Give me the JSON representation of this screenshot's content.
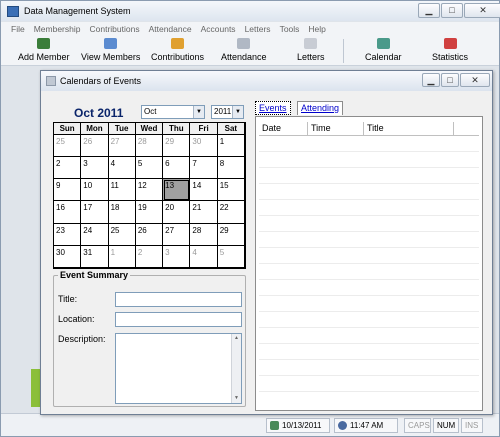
{
  "main_window": {
    "title": "Data Management System",
    "controls": {
      "minimize": "▁",
      "maximize": "□",
      "close": "✕"
    }
  },
  "menu": [
    "File",
    "Membership",
    "Contributions",
    "Attendance",
    "Accounts",
    "Letters",
    "Tools",
    "Help"
  ],
  "toolbar": [
    {
      "label": "Add Member",
      "icon": "add-member-icon",
      "color": "#3a7d3a"
    },
    {
      "label": "View Members",
      "icon": "view-members-icon",
      "color": "#5b8bd0"
    },
    {
      "label": "Contributions",
      "icon": "contributions-icon",
      "color": "#e0a030"
    },
    {
      "label": "Attendance",
      "icon": "attendance-icon",
      "color": "#b0b8c4"
    },
    {
      "label": "Letters",
      "icon": "letters-icon",
      "color": "#c8ccd4"
    },
    {
      "label": "Calendar",
      "icon": "calendar-icon",
      "color": "#4a9a8a"
    },
    {
      "label": "Statistics",
      "icon": "statistics-icon",
      "color": "#d04040"
    }
  ],
  "dialog": {
    "title": "Calendars of Events",
    "controls": {
      "minimize": "▁",
      "maximize": "□",
      "close": "✕"
    },
    "calendar": {
      "month_label": "Oct 2011",
      "month_select": "Oct",
      "year_select": "2011",
      "day_headers": [
        "Sun",
        "Mon",
        "Tue",
        "Wed",
        "Thu",
        "Fri",
        "Sat"
      ],
      "selected_day": "13",
      "weeks": [
        [
          {
            "d": "25",
            "o": true
          },
          {
            "d": "26",
            "o": true
          },
          {
            "d": "27",
            "o": true
          },
          {
            "d": "28",
            "o": true
          },
          {
            "d": "29",
            "o": true
          },
          {
            "d": "30",
            "o": true
          },
          {
            "d": "1",
            "o": false
          }
        ],
        [
          {
            "d": "2",
            "o": false
          },
          {
            "d": "3",
            "o": false
          },
          {
            "d": "4",
            "o": false
          },
          {
            "d": "5",
            "o": false
          },
          {
            "d": "6",
            "o": false
          },
          {
            "d": "7",
            "o": false
          },
          {
            "d": "8",
            "o": false
          }
        ],
        [
          {
            "d": "9",
            "o": false
          },
          {
            "d": "10",
            "o": false
          },
          {
            "d": "11",
            "o": false
          },
          {
            "d": "12",
            "o": false
          },
          {
            "d": "13",
            "o": false
          },
          {
            "d": "14",
            "o": false
          },
          {
            "d": "15",
            "o": false
          }
        ],
        [
          {
            "d": "16",
            "o": false
          },
          {
            "d": "17",
            "o": false
          },
          {
            "d": "18",
            "o": false
          },
          {
            "d": "19",
            "o": false
          },
          {
            "d": "20",
            "o": false
          },
          {
            "d": "21",
            "o": false
          },
          {
            "d": "22",
            "o": false
          }
        ],
        [
          {
            "d": "23",
            "o": false
          },
          {
            "d": "24",
            "o": false
          },
          {
            "d": "25",
            "o": false
          },
          {
            "d": "26",
            "o": false
          },
          {
            "d": "27",
            "o": false
          },
          {
            "d": "28",
            "o": false
          },
          {
            "d": "29",
            "o": false
          }
        ],
        [
          {
            "d": "30",
            "o": false
          },
          {
            "d": "31",
            "o": false
          },
          {
            "d": "1",
            "o": true
          },
          {
            "d": "2",
            "o": true
          },
          {
            "d": "3",
            "o": true
          },
          {
            "d": "4",
            "o": true
          },
          {
            "d": "5",
            "o": true
          }
        ]
      ]
    },
    "summary": {
      "legend": "Event Summary",
      "title_label": "Title:",
      "location_label": "Location:",
      "description_label": "Description:",
      "title_value": "",
      "location_value": ""
    },
    "tabs": [
      "Events",
      "Attending"
    ],
    "list_columns": [
      "Date",
      "Time",
      "Title"
    ]
  },
  "statusbar": {
    "date": "10/13/2011",
    "time": "11:47 AM",
    "caps": "CAPS",
    "num": "NUM",
    "ins": "INS"
  }
}
